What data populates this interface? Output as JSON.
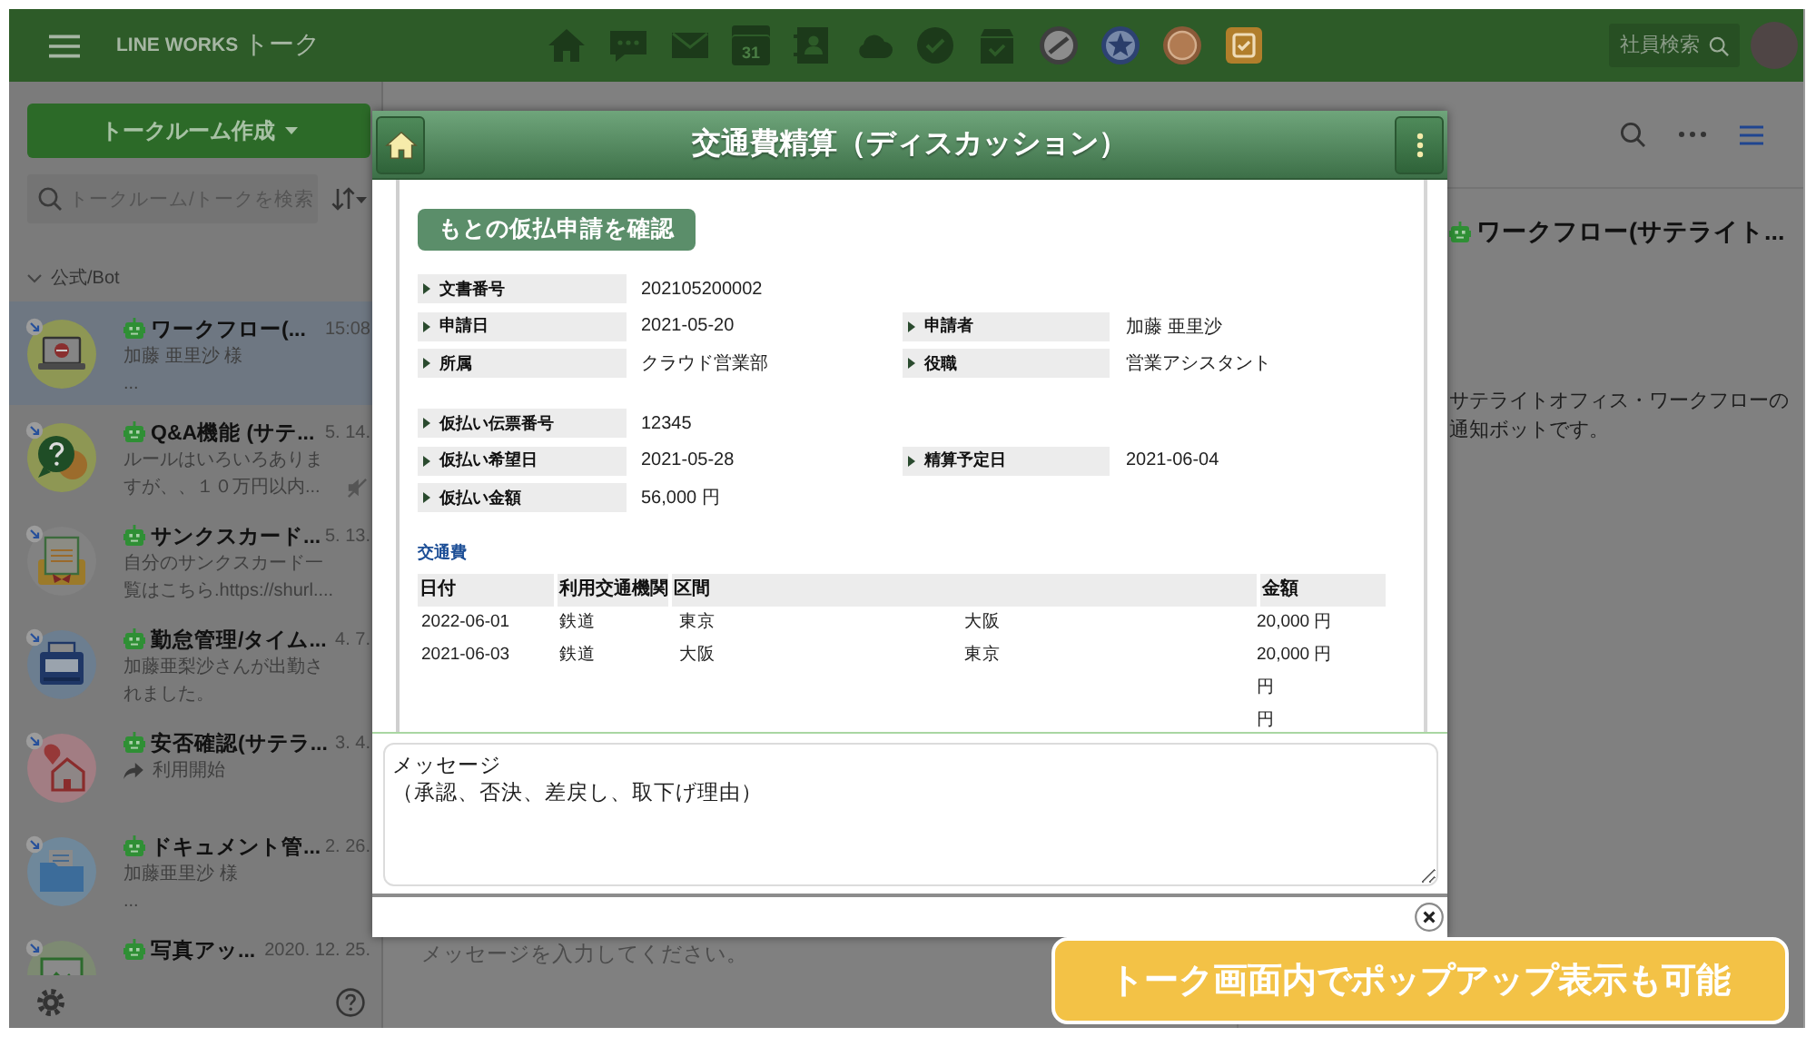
{
  "top_bar": {
    "logo": "LINE WORKS",
    "title": "トーク",
    "calendar_label": "31",
    "search": {
      "placeholder": "社員検索"
    }
  },
  "sidebar": {
    "create_button": "トークルーム作成",
    "search": {
      "placeholder": "トークルーム/トークを検索"
    },
    "section": {
      "label": "公式/Bot",
      "expanded": true
    },
    "rooms": [
      {
        "name": "ワークフロー(...",
        "time": "15:08",
        "preview": "加藤 亜里沙 様\n...",
        "selected": true,
        "muted": false,
        "shared": false
      },
      {
        "name": "Q&A機能 (サテ...",
        "time": "5. 14.",
        "preview": "ルールはいろいろありますが、、１０万円以内...",
        "selected": false,
        "muted": true,
        "shared": false
      },
      {
        "name": "サンクスカード...",
        "time": "5. 13.",
        "preview": "自分のサンクスカード一覧はこちら.https://shurl....",
        "selected": false,
        "muted": false,
        "shared": false
      },
      {
        "name": "勤怠管理/タイム...",
        "time": "4. 7.",
        "preview": "加藤亜梨沙さんが出勤されました。",
        "selected": false,
        "muted": false,
        "shared": false
      },
      {
        "name": "安否確認(サテラ...",
        "time": "3. 4.",
        "preview": "利用開始",
        "selected": false,
        "muted": false,
        "shared": true
      },
      {
        "name": "ドキュメント管...",
        "time": "2. 26.",
        "preview": "加藤亜里沙 様\n...",
        "selected": false,
        "muted": false,
        "shared": false
      },
      {
        "name": "写真アッ...",
        "time": "2020. 12. 25.",
        "selected": false,
        "muted": false,
        "shared": false
      }
    ]
  },
  "chat": {
    "input": {
      "placeholder": "メッセージを入力してください。"
    }
  },
  "info_panel": {
    "title": "ワークフロー(サテライト...",
    "description": "サテライトオフィス・ワークフローの通知ボットです。"
  },
  "dialog": {
    "title": "交通費精算（ディスカッション）",
    "action_button": "もとの仮払申請を確認",
    "field_groups": [
      {
        "rows": [
          [
            {
              "label": "文書番号",
              "value": "202105200002"
            }
          ],
          [
            {
              "label": "申請日",
              "value": "2021-05-20"
            },
            {
              "label": "申請者",
              "value": "加藤 亜里沙"
            }
          ],
          [
            {
              "label": "所属",
              "value": "クラウド営業部"
            },
            {
              "label": "役職",
              "value": "営業アシスタント"
            }
          ]
        ]
      },
      {
        "rows": [
          [
            {
              "label": "仮払い伝票番号",
              "value": "12345"
            }
          ],
          [
            {
              "label": "仮払い希望日",
              "value": "2021-05-28"
            },
            {
              "label": "精算予定日",
              "value": "2021-06-04"
            }
          ],
          [
            {
              "label": "仮払い金額",
              "value": "56,000 円"
            }
          ]
        ]
      }
    ],
    "section_title": "交通費",
    "table": {
      "columns": [
        "日付",
        "利用交通機関",
        "区間",
        "金額"
      ],
      "rows": [
        {
          "date": "2022-06-01",
          "transport": "鉄道",
          "from": "東京",
          "to": "大阪",
          "amount": "20,000 円"
        },
        {
          "date": "2021-06-03",
          "transport": "鉄道",
          "from": "大阪",
          "to": "東京",
          "amount": "20,000 円"
        },
        {
          "amount": "円"
        },
        {
          "amount": "円"
        }
      ]
    },
    "message": {
      "placeholder": [
        "メッセージ",
        "（承認、否決、差戻し、取下げ理由）"
      ]
    }
  },
  "callout": {
    "text": "トーク画面内でポップアップ表示も可能"
  }
}
